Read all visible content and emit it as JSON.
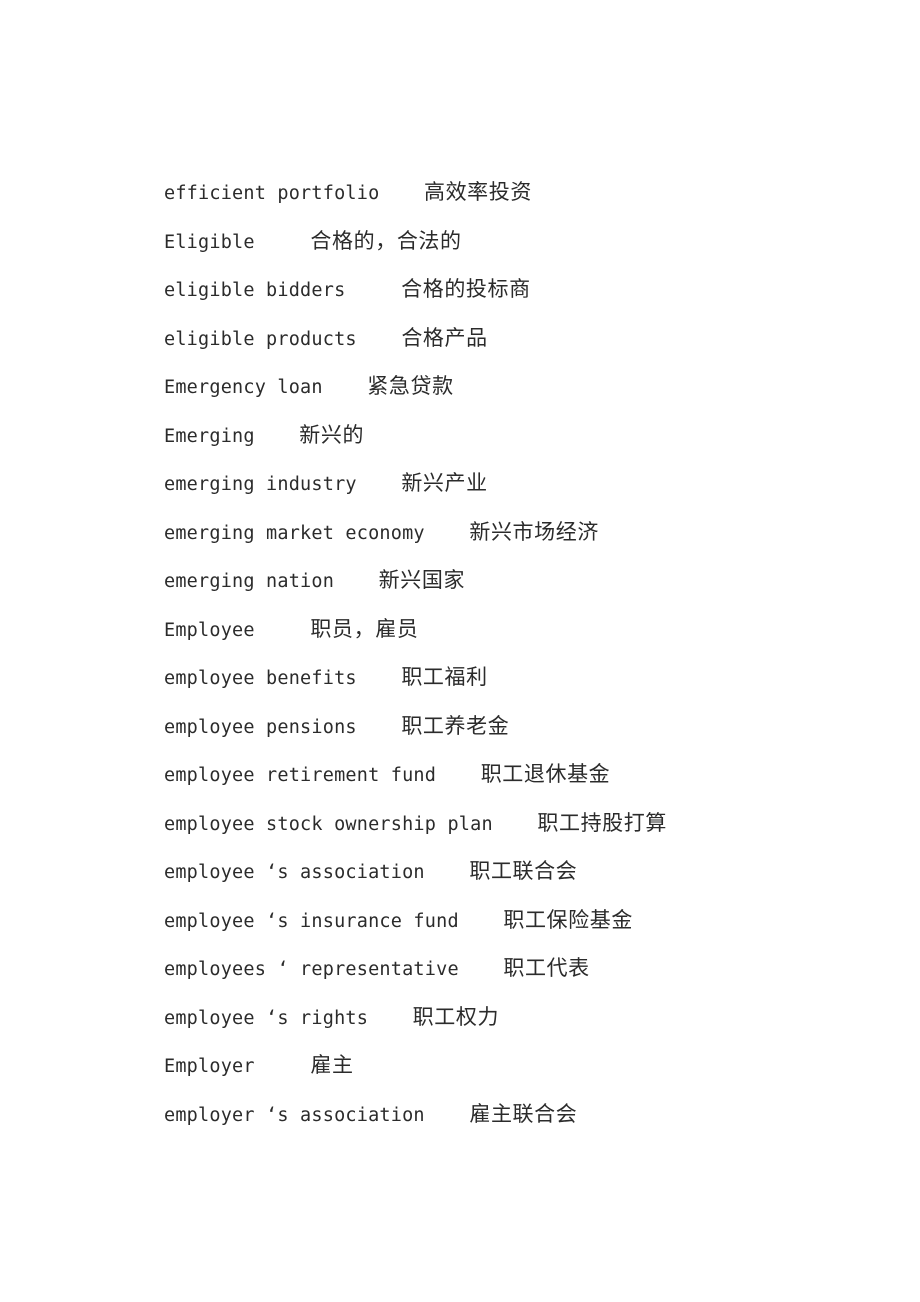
{
  "document": {
    "type": "bilingual-glossary",
    "language_pair": "English-Chinese",
    "background_color": "#ffffff",
    "text_color": "#2b2b2b",
    "entry_count": 20
  },
  "entries": [
    {
      "term": "efficient portfolio",
      "gap": "    ",
      "gloss": "高效率投资"
    },
    {
      "term": "Eligible",
      "gap": "     ",
      "gloss": "合格的，合法的"
    },
    {
      "term": "eligible bidders",
      "gap": "     ",
      "gloss": "合格的投标商"
    },
    {
      "term": "eligible products",
      "gap": "    ",
      "gloss": "合格产品"
    },
    {
      "term": "Emergency loan",
      "gap": "    ",
      "gloss": "紧急贷款"
    },
    {
      "term": "Emerging",
      "gap": "    ",
      "gloss": "新兴的"
    },
    {
      "term": "emerging industry",
      "gap": "    ",
      "gloss": "新兴产业"
    },
    {
      "term": "emerging market economy",
      "gap": "    ",
      "gloss": "新兴市场经济"
    },
    {
      "term": "emerging nation",
      "gap": "    ",
      "gloss": "新兴国家"
    },
    {
      "term": "Employee",
      "gap": "     ",
      "gloss": "职员，雇员"
    },
    {
      "term": "employee benefits",
      "gap": "    ",
      "gloss": "职工福利"
    },
    {
      "term": "employee pensions",
      "gap": "    ",
      "gloss": "职工养老金"
    },
    {
      "term": "employee retirement fund",
      "gap": "    ",
      "gloss": "职工退休基金"
    },
    {
      "term": "employee stock ownership plan",
      "gap": "    ",
      "gloss": "职工持股打算"
    },
    {
      "term": "employee ‘s association",
      "gap": "    ",
      "gloss": "职工联合会"
    },
    {
      "term": "employee ‘s insurance fund",
      "gap": "    ",
      "gloss": "职工保险基金"
    },
    {
      "term": "employees ‘ representative",
      "gap": "    ",
      "gloss": "职工代表"
    },
    {
      "term": "employee ‘s rights",
      "gap": "    ",
      "gloss": "职工权力"
    },
    {
      "term": "Employer",
      "gap": "     ",
      "gloss": "雇主"
    },
    {
      "term": "employer ‘s association",
      "gap": "    ",
      "gloss": "雇主联合会"
    }
  ]
}
